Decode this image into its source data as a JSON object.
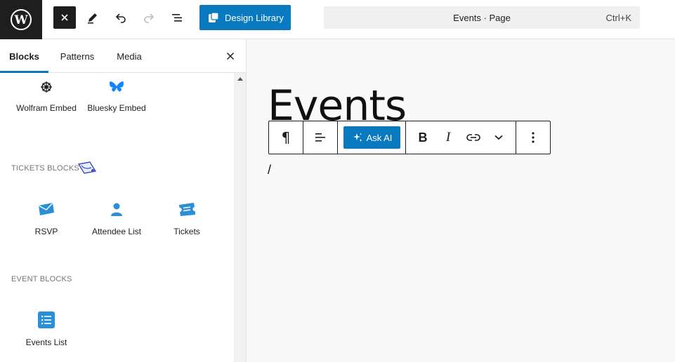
{
  "topbar": {
    "design_library_label": "Design Library",
    "command_title": "Events · Page",
    "command_shortcut": "Ctrl+K"
  },
  "sidebar": {
    "tabs": [
      {
        "label": "Blocks",
        "active": true
      },
      {
        "label": "Patterns",
        "active": false
      },
      {
        "label": "Media",
        "active": false
      }
    ],
    "partial_blocks": [
      {
        "label": "Wolfram Embed",
        "icon": "wolfram-icon"
      },
      {
        "label": "Bluesky Embed",
        "icon": "bluesky-icon"
      }
    ],
    "sections": [
      {
        "label": "TICKETS BLOCKS",
        "icon": "tickets-brand-icon",
        "blocks": [
          {
            "label": "RSVP",
            "icon": "envelope-icon"
          },
          {
            "label": "Attendee List",
            "icon": "person-icon"
          },
          {
            "label": "Tickets",
            "icon": "ticket-icon"
          }
        ]
      },
      {
        "label": "EVENT BLOCKS",
        "blocks": [
          {
            "label": "Events List",
            "icon": "list-icon"
          }
        ]
      }
    ]
  },
  "canvas": {
    "title": "Events",
    "paragraph_text": "/",
    "toolbar": {
      "ask_ai_label": "Ask AI"
    }
  },
  "colors": {
    "accent": "#0a7ac0",
    "dark": "#1e1e1e",
    "canvas_bg": "#f9f9f9",
    "block_icon_blue": "#2a8fd8"
  }
}
